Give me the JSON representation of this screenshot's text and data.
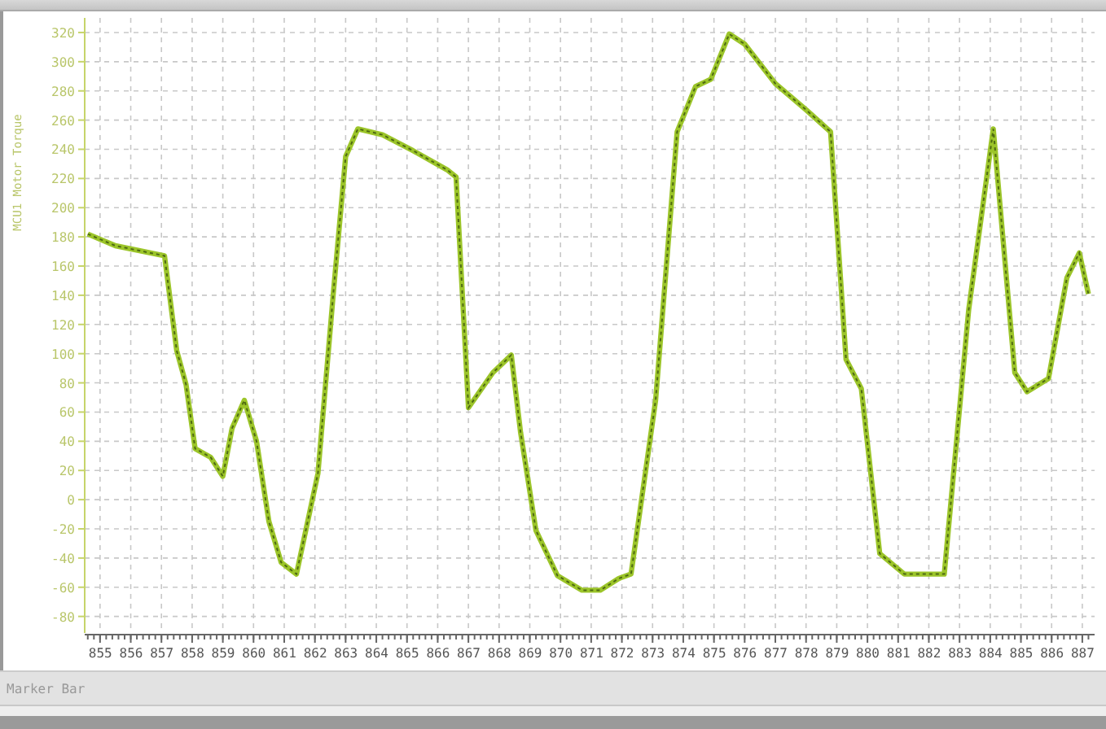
{
  "chart": {
    "chart_data": {
      "type": "line",
      "grid": true,
      "ylabel": "MCU1 Motor Torque",
      "xlim": [
        854.5,
        887.4
      ],
      "ylim": [
        -88,
        330
      ],
      "xticks": [
        855,
        856,
        857,
        858,
        859,
        860,
        861,
        862,
        863,
        864,
        865,
        866,
        867,
        868,
        869,
        870,
        871,
        872,
        873,
        874,
        875,
        876,
        877,
        878,
        879,
        880,
        881,
        882,
        883,
        884,
        885,
        886,
        887
      ],
      "yticks": [
        -80,
        -60,
        -40,
        -20,
        0,
        20,
        40,
        60,
        80,
        100,
        120,
        140,
        160,
        180,
        200,
        220,
        240,
        260,
        280,
        300,
        320
      ],
      "x": [
        854.6,
        855.5,
        857.1,
        857.5,
        857.8,
        858.1,
        858.6,
        859.0,
        859.3,
        859.7,
        860.1,
        860.5,
        860.9,
        861.4,
        862.1,
        862.6,
        863.0,
        863.4,
        864.2,
        865.2,
        866.3,
        866.6,
        867.0,
        867.8,
        868.4,
        868.7,
        869.2,
        869.9,
        870.7,
        871.3,
        871.9,
        872.3,
        873.1,
        873.8,
        874.4,
        874.9,
        875.5,
        876.0,
        877.0,
        878.0,
        878.8,
        879.3,
        879.8,
        880.4,
        881.2,
        882.5,
        883.3,
        884.1,
        884.8,
        885.2,
        885.9,
        886.5,
        886.9,
        887.2
      ],
      "series": [
        {
          "color": "#9cc52a",
          "values": [
            182,
            174,
            167,
            102,
            79,
            35,
            29,
            16,
            49,
            68,
            40,
            -15,
            -43,
            -51,
            18,
            141,
            235,
            254,
            250,
            239,
            226,
            221,
            63,
            87,
            99,
            46,
            -21,
            -52,
            -62,
            -62,
            -54,
            -51,
            68,
            252,
            283,
            288,
            319,
            312,
            285,
            267,
            252,
            96,
            76,
            -37,
            -51,
            -51,
            130,
            254,
            87,
            74,
            83,
            152,
            169,
            141
          ]
        }
      ]
    }
  },
  "marker_bar": {
    "label": "Marker Bar"
  }
}
